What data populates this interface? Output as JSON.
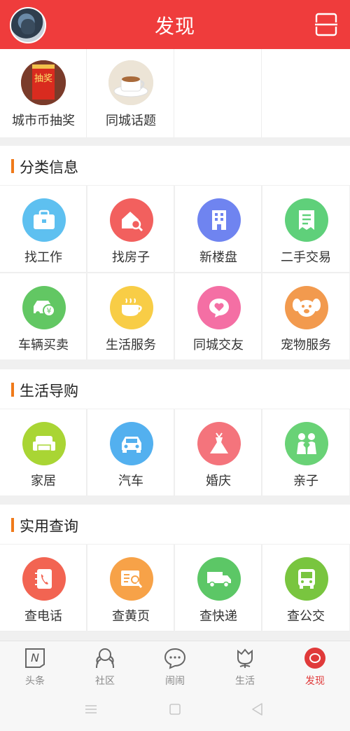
{
  "header": {
    "title": "发现"
  },
  "top_items": [
    {
      "label": "城市币抽奖",
      "badge": "抽奖"
    },
    {
      "label": "同城话题"
    }
  ],
  "sections": [
    {
      "title": "分类信息",
      "items": [
        {
          "label": "找工作",
          "icon": "briefcase-icon",
          "color": "#5ec0f0"
        },
        {
          "label": "找房子",
          "icon": "house-search-icon",
          "color": "#f2605e"
        },
        {
          "label": "新楼盘",
          "icon": "building-icon",
          "color": "#6f84f0"
        },
        {
          "label": "二手交易",
          "icon": "receipt-icon",
          "color": "#5fd07a"
        },
        {
          "label": "车辆买卖",
          "icon": "car-yen-icon",
          "color": "#62c763"
        },
        {
          "label": "生活服务",
          "icon": "coffee-cup-icon",
          "color": "#f8cd46"
        },
        {
          "label": "同城交友",
          "icon": "heart-chat-icon",
          "color": "#f46fa4"
        },
        {
          "label": "宠物服务",
          "icon": "dog-icon",
          "color": "#f29a4e"
        }
      ]
    },
    {
      "title": "生活导购",
      "items": [
        {
          "label": "家居",
          "icon": "sofa-icon",
          "color": "#a9d534"
        },
        {
          "label": "汽车",
          "icon": "car-icon",
          "color": "#53b0ef"
        },
        {
          "label": "婚庆",
          "icon": "dress-icon",
          "color": "#f4747c"
        },
        {
          "label": "亲子",
          "icon": "parent-child-icon",
          "color": "#69d276"
        }
      ]
    },
    {
      "title": "实用查询",
      "items": [
        {
          "label": "查电话",
          "icon": "phone-book-icon",
          "color": "#f26452"
        },
        {
          "label": "查黄页",
          "icon": "yellow-pages-icon",
          "color": "#f7a248"
        },
        {
          "label": "查快递",
          "icon": "truck-icon",
          "color": "#5cc766"
        },
        {
          "label": "查公交",
          "icon": "bus-icon",
          "color": "#79c53f"
        }
      ]
    }
  ],
  "tabs": [
    {
      "label": "头条",
      "icon": "newspaper-n-icon"
    },
    {
      "label": "社区",
      "icon": "community-icon"
    },
    {
      "label": "闹闹",
      "icon": "chat-bubble-icon"
    },
    {
      "label": "生活",
      "icon": "flower-icon"
    },
    {
      "label": "发现",
      "icon": "discover-icon",
      "active": true
    }
  ],
  "colors": {
    "brand": "#ef3c3c",
    "section_bar": "#f07a1a",
    "active_tab": "#e03a3a"
  }
}
